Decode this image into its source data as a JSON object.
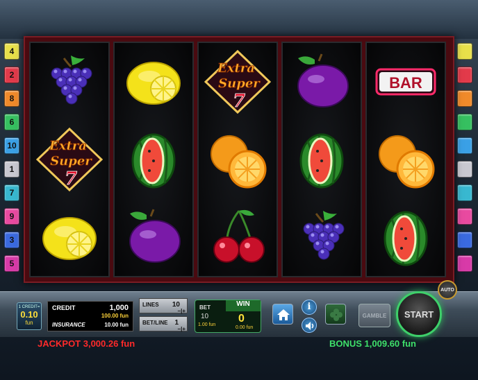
{
  "left_lines": [
    "4",
    "2",
    "8",
    "6",
    "10",
    "1",
    "7",
    "9",
    "3",
    "5"
  ],
  "line_colors": [
    "#e8e04a",
    "#e23a4a",
    "#f08a2a",
    "#36c060",
    "#3aa0e6",
    "#c8c8d0",
    "#38b8d0",
    "#e84aa0",
    "#3a6ae0",
    "#d83aa8"
  ],
  "reels": [
    [
      "grapes-icon",
      "extra-super-7-icon",
      "lemon-icon"
    ],
    [
      "lemon-icon",
      "watermelon-icon",
      "plum-icon"
    ],
    [
      "extra-super-7-icon",
      "orange-icon",
      "cherries-icon"
    ],
    [
      "plum-icon",
      "watermelon-icon",
      "grapes-icon"
    ],
    [
      "bar-icon",
      "orange-icon",
      "watermelon-icon"
    ]
  ],
  "symbol_text": {
    "extra_line1": "Extra",
    "extra_line2": "Super",
    "extra_line3": "7",
    "bar": "BAR"
  },
  "credit_button": {
    "top": "1 CREDIT=",
    "value": "0.10",
    "unit": "fun"
  },
  "credit_box": {
    "credit_label": "CREDIT",
    "credit_value": "1,000",
    "credit_fun": "100.00 fun",
    "insurance_label": "INSURANCE",
    "insurance_value": "10.00 fun"
  },
  "lines": {
    "label": "LINES",
    "value": "10"
  },
  "bet_line": {
    "label": "BET/LINE",
    "value": "1"
  },
  "bet": {
    "label": "BET",
    "value": "10",
    "fun": "1.00 fun"
  },
  "win": {
    "label": "WIN",
    "value": "0",
    "fun": "0.00 fun"
  },
  "buttons": {
    "home": "home-icon",
    "info": "i",
    "sound": "speaker-icon",
    "gamble": "GAMBLE",
    "start": "START",
    "auto": "AUTO"
  },
  "jackpot": "JACKPOT 3,000.26 fun",
  "bonus": "BONUS 1,009.60 fun"
}
